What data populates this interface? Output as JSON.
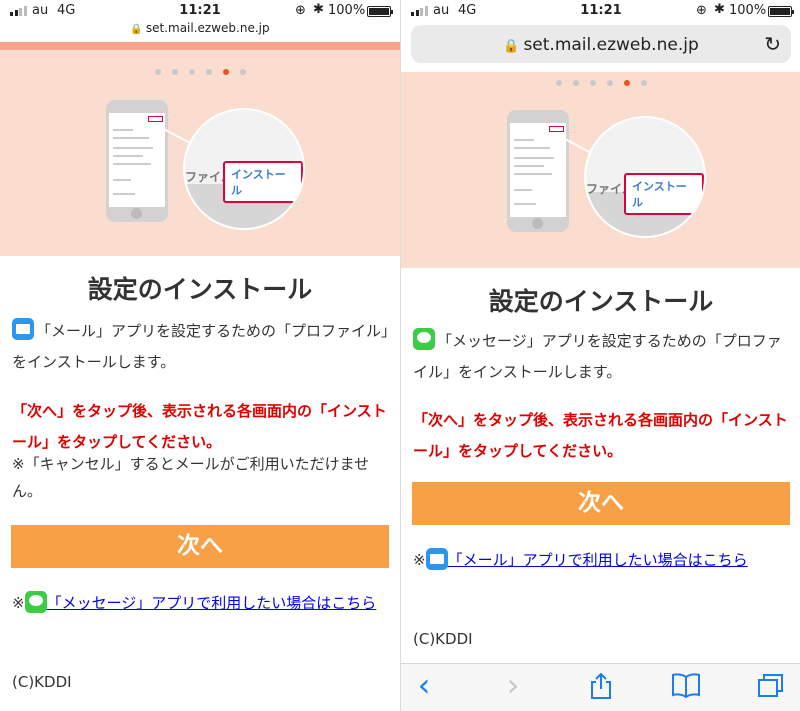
{
  "status_bar": {
    "carrier": "au",
    "network": "4G",
    "time": "11:21",
    "battery": "100%",
    "battery_fill": 1.0
  },
  "url": "set.mail.ezweb.ne.jp",
  "carousel": {
    "dot_count": 6,
    "active_index": 4
  },
  "illustration": {
    "file_label": "ファイル",
    "install_label": "インストール"
  },
  "left": {
    "title": "設定のインストール",
    "intro": "「メール」アプリを設定するための「プロファイル」をインストールします。",
    "instruction": "「次へ」をタップ後、表示される各画面内の「インストール」をタップしてください。",
    "note": "※「キャンセル」するとメールがご利用いただけません。",
    "next_label": "次へ",
    "alt_prefix": "※",
    "alt_link": "「メッセージ」アプリで利用したい場合はこちら",
    "copyright": "(C)KDDI",
    "intro_icon": "mail-app-icon",
    "alt_icon": "messages-app-icon"
  },
  "right": {
    "title": "設定のインストール",
    "intro": "「メッセージ」アプリを設定するための「プロファイル」をインストールします。",
    "instruction": "「次へ」をタップ後、表示される各画面内の「インストール」をタップしてください。",
    "next_label": "次へ",
    "alt_prefix": "※",
    "alt_link": "「メール」アプリで利用したい場合はこちら",
    "copyright": "(C)KDDI",
    "intro_icon": "messages-app-icon",
    "alt_icon": "mail-app-icon"
  },
  "toolbar": {
    "back": "‹",
    "forward": "›",
    "share": "share-icon",
    "bookmarks": "book-icon",
    "tabs": "tabs-icon"
  },
  "colors": {
    "hero_bg": "#fbddd0",
    "accent_button": "#f7a045",
    "active_dot": "#e8541e",
    "red_text": "#e00000",
    "link": "#0000ee",
    "ios_blue": "#1a7df5"
  }
}
